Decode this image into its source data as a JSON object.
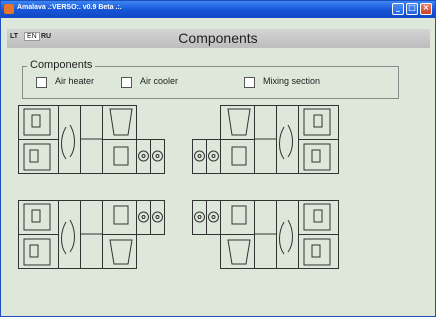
{
  "window": {
    "title": "Amalava .:VERSO:. v0.9 Beta .:."
  },
  "header": {
    "title": "Components",
    "languages": [
      "LT",
      "EN",
      "RU"
    ],
    "selected_language": "EN"
  },
  "components_group": {
    "title": "Components",
    "options": [
      {
        "label": "Air heater",
        "checked": false
      },
      {
        "label": "Air cooler",
        "checked": false
      },
      {
        "label": "Mixing section",
        "checked": false
      }
    ]
  },
  "icons": [
    "app-icon",
    "minimize-icon",
    "maximize-icon",
    "close-icon"
  ],
  "colors": {
    "titlebar": "#1654d6",
    "background": "#dde8da",
    "drawing": "#333333"
  }
}
